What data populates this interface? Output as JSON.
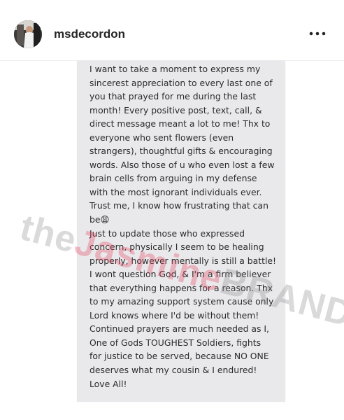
{
  "header": {
    "username": "msdecordon",
    "more_icon": "more-horizontal-icon"
  },
  "post": {
    "note_text": "I want to take a moment to express my\nsincerest appreciation to every last one of\nyou that prayed for me during the last\nmonth! Every positive post, text, call, &\ndirect message meant a lot to me! Thx to\neveryone who sent flowers (even\nstrangers), thoughtful gifts & encouraging\nwords. Also those of u who even lost a few\nbrain cells from arguing in my defense\nwith the most ignorant individuals ever.\nTrust me, I know how frustrating that can\nbe😩\nJust to update those who expressed\nconcern, physically I seem to be healing\nproperly, however mentally is still a battle!\nI wont question God, & I'm a firm believer\nthat everything happens for a reason. Thx\nto my amazing support system cause only\nLord knows where I'd be without them!\nContinued prayers are much needed as I,\nOne of Gods TOUGHEST Soldiers, fights\nfor justice to be served, because NO ONE\ndeserves what my cousin & I endured!\nLove All!",
    "watermark": {
      "part1": "the",
      "part2": "Jasmine",
      "part3": "BRAND"
    }
  }
}
